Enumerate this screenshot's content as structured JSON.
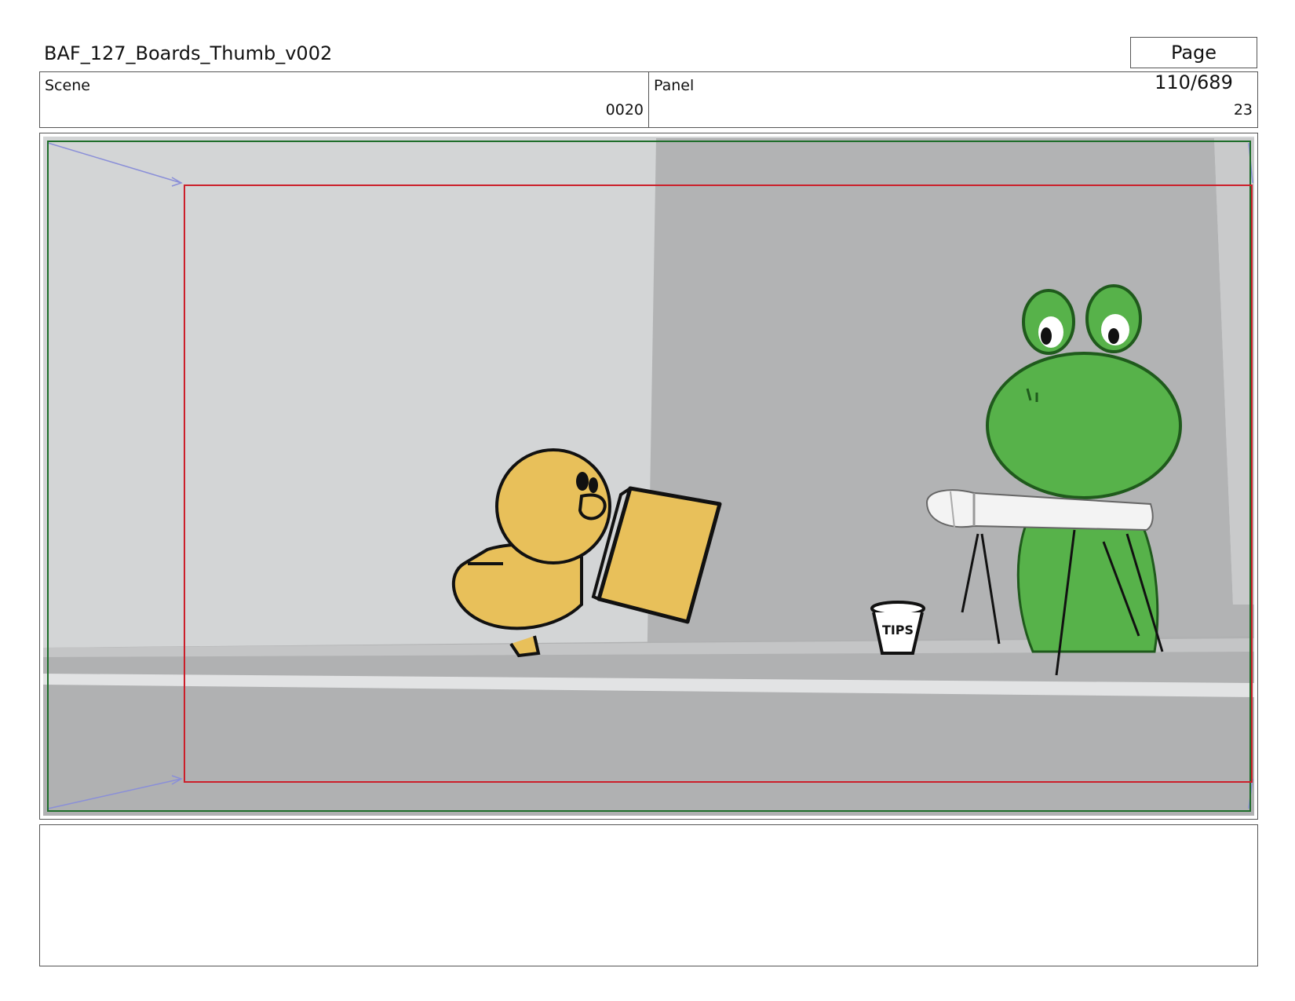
{
  "header": {
    "document_title": "BAF_127_Boards_Thumb_v002",
    "page_indicator": "Page 110/689"
  },
  "info": {
    "scene_label": "Scene",
    "scene_value": "0020",
    "panel_label": "Panel",
    "panel_value": "23"
  },
  "panel": {
    "tips_cup_text": "TIPS",
    "colors": {
      "safe_frame": "#cc1f2a",
      "camera_frame": "#1e6e2a",
      "camera_guides": "#8a8fd8",
      "duck_yellow": "#e8c05a",
      "frog_green": "#57b24a"
    }
  },
  "notes": {
    "text": ""
  }
}
